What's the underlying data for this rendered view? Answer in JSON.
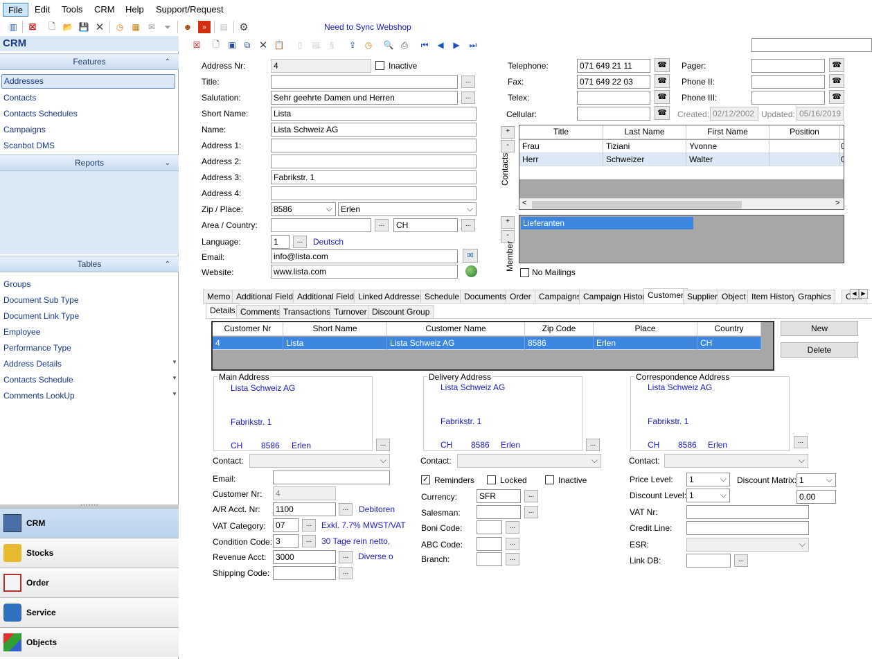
{
  "menu": {
    "file": "File",
    "edit": "Edit",
    "tools": "Tools",
    "crm": "CRM",
    "help": "Help",
    "support": "Support/Request"
  },
  "sync": "Need to Sync Webshop",
  "sidebar": {
    "title": "CRM",
    "features": "Features",
    "reports": "Reports",
    "tables": "Tables",
    "feature_items": [
      "Addresses",
      "Contacts",
      "Contacts  Schedules",
      "Campaigns",
      "Scanbot DMS"
    ],
    "table_items": [
      "Groups",
      "Document Sub Type",
      "Document Link Type",
      "Employee",
      "Performance Type",
      "Address Details",
      "Contacts  Schedule",
      "Comments LookUp"
    ],
    "nav": [
      "CRM",
      "Stocks",
      "Order",
      "Service",
      "Objects"
    ]
  },
  "form": {
    "address_nr_label": "Address Nr:",
    "address_nr": "4",
    "inactive_label": "Inactive",
    "title_label": "Title:",
    "title": "",
    "salutation_label": "Salutation:",
    "salutation": "Sehr geehrte Damen und Herren",
    "short_name_label": "Short Name:",
    "short_name": "Lista",
    "name_label": "Name:",
    "name": "Lista Schweiz AG",
    "address1_label": "Address 1:",
    "address1": "",
    "address2_label": "Address 2:",
    "address2": "",
    "address3_label": "Address 3:",
    "address3": "Fabrikstr. 1",
    "address4_label": "Address 4:",
    "address4": "",
    "zip_label": "Zip / Place:",
    "zip": "8586",
    "place": "Erlen",
    "area_label": "Area / Country:",
    "area": "",
    "country": "CH",
    "language_label": "Language:",
    "language": "1",
    "language_name": "Deutsch",
    "email_label": "Email:",
    "email": "info@lista.com",
    "website_label": "Website:",
    "website": "www.lista.com",
    "telephone_label": "Telephone:",
    "telephone": "071 649 21 11",
    "fax_label": "Fax:",
    "fax": "071 649 22 03",
    "telex_label": "Telex:",
    "telex": "",
    "cellular_label": "Cellular:",
    "cellular": "",
    "pager_label": "Pager:",
    "pager": "",
    "phone2_label": "Phone II:",
    "phone2": "",
    "phone3_label": "Phone III:",
    "phone3": "",
    "created_label": "Created:",
    "created": "02/12/2002",
    "updated_label": "Updated:",
    "updated": "05/16/2019",
    "contacts_label": "Contacts",
    "member_label": "Member",
    "no_mailings_label": "No Mailings",
    "member_item": "Lieferanten"
  },
  "contacts_grid": {
    "headers": [
      "Title",
      "Last Name",
      "First Name",
      "Position"
    ],
    "rows": [
      [
        "Frau",
        "Tiziani",
        "Yvonne",
        "",
        "0"
      ],
      [
        "Herr",
        "Schweizer",
        "Walter",
        "",
        "0"
      ]
    ]
  },
  "tabs": [
    "Memo",
    "Additional Fields",
    "Additional Fields",
    "Linked Addresses",
    "Schedule",
    "Documents",
    "Order",
    "Campaigns",
    "Campaign History",
    "Customer",
    "Supplier",
    "Object",
    "Item History",
    "Graphics",
    "Call:"
  ],
  "subtabs": [
    "Details",
    "Comments",
    "Transactions",
    "Turnover",
    "Discount Group"
  ],
  "customer_grid": {
    "headers": [
      "Customer Nr",
      "Short Name",
      "Customer Name",
      "Zip Code",
      "Place",
      "Country"
    ],
    "rows": [
      [
        "4",
        "Lista",
        "Lista Schweiz AG",
        "8586",
        "Erlen",
        "CH"
      ]
    ]
  },
  "buttons": {
    "new": "New",
    "delete": "Delete",
    "dots": "..."
  },
  "main_address": {
    "title": "Main Address",
    "name": "Lista Schweiz AG",
    "street": "Fabrikstr. 1",
    "country": "CH",
    "zip": "8586",
    "place": "Erlen"
  },
  "delivery_address": {
    "title": "Delivery Address",
    "name": "Lista Schweiz AG",
    "street": "Fabrikstr. 1",
    "country": "CH",
    "zip": "8586",
    "place": "Erlen"
  },
  "correspondence_address": {
    "title": "Correspondence Address",
    "name": "Lista Schweiz AG",
    "street": "Fabrikstr. 1",
    "country": "CH",
    "zip": "8586",
    "place": "Erlen"
  },
  "customer": {
    "contact_label": "Contact:",
    "email_label": "Email:",
    "email": "",
    "customer_nr_label": "Customer Nr:",
    "customer_nr": "4",
    "ar_label": "A/R Acct. Nr:",
    "ar": "1100",
    "ar_name": "Debitoren",
    "vat_cat_label": "VAT Category:",
    "vat_cat": "07",
    "vat_cat_name": "Exkl. 7.7% MWST/VAT",
    "cond_label": "Condition Code:",
    "cond": "3",
    "cond_name": "30 Tage rein netto,",
    "rev_label": "Revenue Acct:",
    "rev": "3000",
    "rev_name": "Diverse o",
    "ship_label": "Shipping Code:",
    "ship": "",
    "reminders_label": "Reminders",
    "locked_label": "Locked",
    "inactive_label": "Inactive",
    "currency_label": "Currency:",
    "currency": "SFR",
    "salesman_label": "Salesman:",
    "salesman": "",
    "boni_label": "Boni Code:",
    "abc_label": "ABC Code:",
    "branch_label": "Branch:",
    "price_label": "Price Level:",
    "price": "1",
    "discount_matrix_label": "Discount Matrix:",
    "discount_matrix": "1",
    "discount_level_label": "Discount Level:",
    "discount_level": "1",
    "discount_value": "0.00",
    "vat_nr_label": "VAT Nr:",
    "credit_label": "Credit Line:",
    "esr_label": "ESR:",
    "linkdb_label": "Link DB:"
  }
}
